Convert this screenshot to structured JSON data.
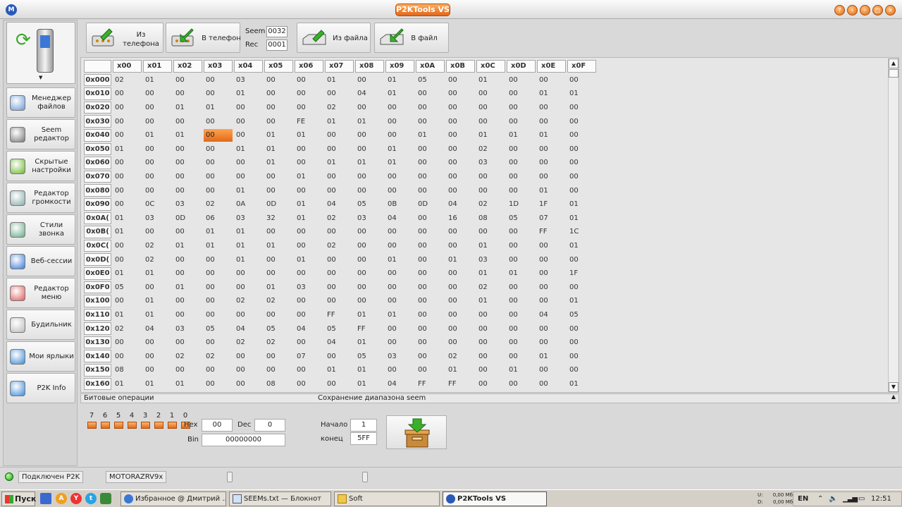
{
  "window": {
    "title": "P2KTools VS",
    "buttons": [
      "help",
      "back",
      "minimize",
      "maximize",
      "close"
    ]
  },
  "sidebar": {
    "items": [
      {
        "label": "Менеджер файлов",
        "icon": "file-manager-icon"
      },
      {
        "label": "Seem редактор",
        "icon": "seem-editor-icon"
      },
      {
        "label": "Скрытые настройки",
        "icon": "gear-icon"
      },
      {
        "label": "Редактор громкости",
        "icon": "volume-icon"
      },
      {
        "label": "Стили звонка",
        "icon": "ring-style-icon"
      },
      {
        "label": "Веб-сессии",
        "icon": "globe-icon"
      },
      {
        "label": "Редактор меню",
        "icon": "menu-editor-icon"
      },
      {
        "label": "Будильник",
        "icon": "clock-icon"
      },
      {
        "label": "Мои ярлыки",
        "icon": "shortcuts-icon"
      },
      {
        "label": "P2K Info",
        "icon": "info-icon"
      }
    ]
  },
  "toolbar": {
    "from_phone": "Из телефона",
    "to_phone": "В телефон",
    "seem_label": "Seem",
    "seem_value": "0032",
    "rec_label": "Rec",
    "rec_value": "0001",
    "from_file": "Из файла",
    "to_file": "В файл"
  },
  "grid": {
    "columns": [
      "x00",
      "x01",
      "x02",
      "x03",
      "x04",
      "x05",
      "x06",
      "x07",
      "x08",
      "x09",
      "x0A",
      "x0B",
      "x0C",
      "x0D",
      "x0E",
      "x0F"
    ],
    "rows": [
      {
        "addr": "0x000",
        "cells": [
          "02",
          "01",
          "00",
          "00",
          "03",
          "00",
          "00",
          "01",
          "00",
          "01",
          "05",
          "00",
          "01",
          "00",
          "00",
          "00"
        ]
      },
      {
        "addr": "0x010",
        "cells": [
          "00",
          "00",
          "00",
          "00",
          "01",
          "00",
          "00",
          "00",
          "04",
          "01",
          "00",
          "00",
          "00",
          "00",
          "01",
          "01"
        ]
      },
      {
        "addr": "0x020",
        "cells": [
          "00",
          "00",
          "01",
          "01",
          "00",
          "00",
          "00",
          "02",
          "00",
          "00",
          "00",
          "00",
          "00",
          "00",
          "00",
          "00"
        ]
      },
      {
        "addr": "0x030",
        "cells": [
          "00",
          "00",
          "00",
          "00",
          "00",
          "00",
          "FE",
          "01",
          "01",
          "00",
          "00",
          "00",
          "00",
          "00",
          "00",
          "00"
        ]
      },
      {
        "addr": "0x040",
        "cells": [
          "00",
          "01",
          "01",
          "00",
          "00",
          "01",
          "01",
          "00",
          "00",
          "00",
          "01",
          "00",
          "01",
          "01",
          "01",
          "00"
        ]
      },
      {
        "addr": "0x050",
        "cells": [
          "01",
          "00",
          "00",
          "00",
          "01",
          "01",
          "00",
          "00",
          "00",
          "01",
          "00",
          "00",
          "02",
          "00",
          "00",
          "00"
        ]
      },
      {
        "addr": "0x060",
        "cells": [
          "00",
          "00",
          "00",
          "00",
          "00",
          "01",
          "00",
          "01",
          "01",
          "01",
          "00",
          "00",
          "03",
          "00",
          "00",
          "00"
        ]
      },
      {
        "addr": "0x070",
        "cells": [
          "00",
          "00",
          "00",
          "00",
          "00",
          "00",
          "01",
          "00",
          "00",
          "00",
          "00",
          "00",
          "00",
          "00",
          "00",
          "00"
        ]
      },
      {
        "addr": "0x080",
        "cells": [
          "00",
          "00",
          "00",
          "00",
          "01",
          "00",
          "00",
          "00",
          "00",
          "00",
          "00",
          "00",
          "00",
          "00",
          "01",
          "00"
        ]
      },
      {
        "addr": "0x090",
        "cells": [
          "00",
          "0C",
          "03",
          "02",
          "0A",
          "0D",
          "01",
          "04",
          "05",
          "0B",
          "0D",
          "04",
          "02",
          "1D",
          "1F",
          "01"
        ]
      },
      {
        "addr": "0x0A(",
        "cells": [
          "01",
          "03",
          "0D",
          "06",
          "03",
          "32",
          "01",
          "02",
          "03",
          "04",
          "00",
          "16",
          "08",
          "05",
          "07",
          "01"
        ]
      },
      {
        "addr": "0x0B(",
        "cells": [
          "01",
          "00",
          "00",
          "01",
          "01",
          "00",
          "00",
          "00",
          "00",
          "00",
          "00",
          "00",
          "00",
          "00",
          "FF",
          "1C"
        ]
      },
      {
        "addr": "0x0C(",
        "cells": [
          "00",
          "02",
          "01",
          "01",
          "01",
          "01",
          "00",
          "02",
          "00",
          "00",
          "00",
          "00",
          "01",
          "00",
          "00",
          "01"
        ]
      },
      {
        "addr": "0x0D(",
        "cells": [
          "00",
          "02",
          "00",
          "00",
          "01",
          "00",
          "01",
          "00",
          "00",
          "01",
          "00",
          "01",
          "03",
          "00",
          "00",
          "00"
        ]
      },
      {
        "addr": "0x0E0",
        "cells": [
          "01",
          "01",
          "00",
          "00",
          "00",
          "00",
          "00",
          "00",
          "00",
          "00",
          "00",
          "00",
          "01",
          "01",
          "00",
          "1F"
        ]
      },
      {
        "addr": "0x0F0",
        "cells": [
          "05",
          "00",
          "01",
          "00",
          "00",
          "01",
          "03",
          "00",
          "00",
          "00",
          "00",
          "00",
          "02",
          "00",
          "00",
          "00"
        ]
      },
      {
        "addr": "0x100",
        "cells": [
          "00",
          "01",
          "00",
          "00",
          "02",
          "02",
          "00",
          "00",
          "00",
          "00",
          "00",
          "00",
          "01",
          "00",
          "00",
          "01"
        ]
      },
      {
        "addr": "0x110",
        "cells": [
          "01",
          "01",
          "00",
          "00",
          "00",
          "00",
          "00",
          "FF",
          "01",
          "01",
          "00",
          "00",
          "00",
          "00",
          "04",
          "05"
        ]
      },
      {
        "addr": "0x120",
        "cells": [
          "02",
          "04",
          "03",
          "05",
          "04",
          "05",
          "04",
          "05",
          "FF",
          "00",
          "00",
          "00",
          "00",
          "00",
          "00",
          "00"
        ]
      },
      {
        "addr": "0x130",
        "cells": [
          "00",
          "00",
          "00",
          "00",
          "02",
          "02",
          "00",
          "04",
          "01",
          "00",
          "00",
          "00",
          "00",
          "00",
          "00",
          "00"
        ]
      },
      {
        "addr": "0x140",
        "cells": [
          "00",
          "00",
          "02",
          "02",
          "00",
          "00",
          "07",
          "00",
          "05",
          "03",
          "00",
          "02",
          "00",
          "00",
          "01",
          "00"
        ]
      },
      {
        "addr": "0x150",
        "cells": [
          "08",
          "00",
          "00",
          "00",
          "00",
          "00",
          "00",
          "01",
          "01",
          "00",
          "00",
          "01",
          "00",
          "01",
          "00",
          "00"
        ]
      },
      {
        "addr": "0x160",
        "cells": [
          "01",
          "01",
          "01",
          "00",
          "00",
          "08",
          "00",
          "00",
          "01",
          "04",
          "FF",
          "FF",
          "00",
          "00",
          "00",
          "01"
        ]
      }
    ]
  },
  "bitops": {
    "title": "Битовые операции",
    "bits": [
      "7",
      "6",
      "5",
      "4",
      "3",
      "2",
      "1",
      "0"
    ],
    "hex_label": "Hex",
    "hex_value": "00",
    "dec_label": "Dec",
    "dec_value": "0",
    "bin_label": "Bin",
    "bin_value": "00000000"
  },
  "save_range": {
    "title": "Сохранение диапазона seem",
    "start_label": "Начало",
    "start_value": "1",
    "end_label": "конец",
    "end_value": "5FF"
  },
  "status": {
    "connected": "Подключен P2K",
    "model": "MOTORAZRV9x"
  },
  "taskbar": {
    "start": "Пуск",
    "tasks": [
      "Избранное @ Дмитрий ...",
      "SEEMs.txt — Блокнот",
      "Soft",
      "P2KTools VS"
    ],
    "net_up": "U:",
    "net_down": "D:",
    "net_up_val": "0,00 Мб/с",
    "net_down_val": "0,00 Мб/с",
    "lang": "EN",
    "time": "12:51"
  },
  "colors": {
    "accent": "#e8782a",
    "selected_cell": "#f08a3c",
    "status_led": "#22aa22"
  }
}
